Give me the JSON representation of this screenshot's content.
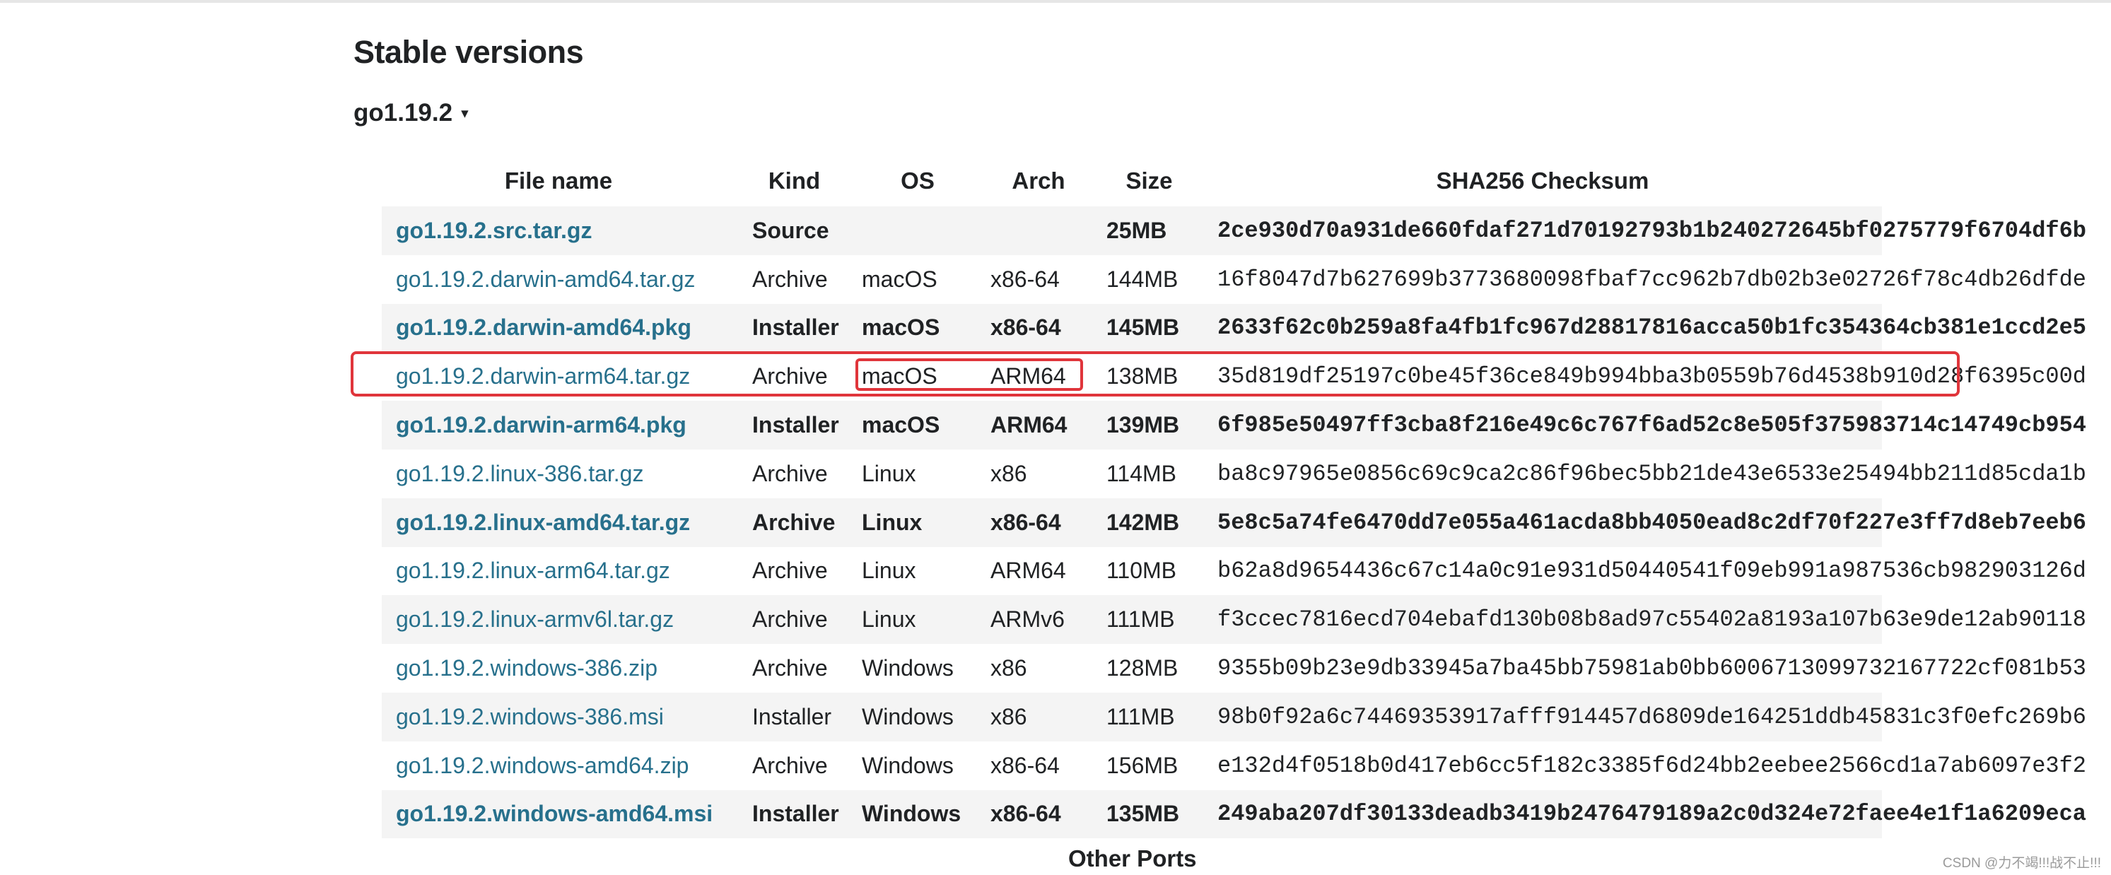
{
  "section": {
    "title": "Stable versions",
    "version_label": "go1.19.2",
    "version_caret": "▾"
  },
  "table": {
    "headers": {
      "file_name": "File name",
      "kind": "Kind",
      "os": "OS",
      "arch": "Arch",
      "size": "Size",
      "checksum": "SHA256 Checksum"
    },
    "rows": [
      {
        "file": "go1.19.2.src.tar.gz",
        "kind": "Source",
        "os": "",
        "arch": "",
        "size": "25MB",
        "checksum": "2ce930d70a931de660fdaf271d70192793b1b240272645bf0275779f6704df6b",
        "featured": true
      },
      {
        "file": "go1.19.2.darwin-amd64.tar.gz",
        "kind": "Archive",
        "os": "macOS",
        "arch": "x86-64",
        "size": "144MB",
        "checksum": "16f8047d7b627699b3773680098fbaf7cc962b7db02b3e02726f78c4db26dfde",
        "featured": false
      },
      {
        "file": "go1.19.2.darwin-amd64.pkg",
        "kind": "Installer",
        "os": "macOS",
        "arch": "x86-64",
        "size": "145MB",
        "checksum": "2633f62c0b259a8fa4fb1fc967d28817816acca50b1fc354364cb381e1ccd2e5",
        "featured": true
      },
      {
        "file": "go1.19.2.darwin-arm64.tar.gz",
        "kind": "Archive",
        "os": "macOS",
        "arch": "ARM64",
        "size": "138MB",
        "checksum": "35d819df25197c0be45f36ce849b994bba3b0559b76d4538b910d28f6395c00d",
        "featured": false
      },
      {
        "file": "go1.19.2.darwin-arm64.pkg",
        "kind": "Installer",
        "os": "macOS",
        "arch": "ARM64",
        "size": "139MB",
        "checksum": "6f985e50497ff3cba8f216e49c6c767f6ad52c8e505f375983714c14749cb954",
        "featured": true
      },
      {
        "file": "go1.19.2.linux-386.tar.gz",
        "kind": "Archive",
        "os": "Linux",
        "arch": "x86",
        "size": "114MB",
        "checksum": "ba8c97965e0856c69c9ca2c86f96bec5bb21de43e6533e25494bb211d85cda1b",
        "featured": false
      },
      {
        "file": "go1.19.2.linux-amd64.tar.gz",
        "kind": "Archive",
        "os": "Linux",
        "arch": "x86-64",
        "size": "142MB",
        "checksum": "5e8c5a74fe6470dd7e055a461acda8bb4050ead8c2df70f227e3ff7d8eb7eeb6",
        "featured": true
      },
      {
        "file": "go1.19.2.linux-arm64.tar.gz",
        "kind": "Archive",
        "os": "Linux",
        "arch": "ARM64",
        "size": "110MB",
        "checksum": "b62a8d9654436c67c14a0c91e931d50440541f09eb991a987536cb982903126d",
        "featured": false
      },
      {
        "file": "go1.19.2.linux-armv6l.tar.gz",
        "kind": "Archive",
        "os": "Linux",
        "arch": "ARMv6",
        "size": "111MB",
        "checksum": "f3ccec7816ecd704ebafd130b08b8ad97c55402a8193a107b63e9de12ab90118",
        "featured": false
      },
      {
        "file": "go1.19.2.windows-386.zip",
        "kind": "Archive",
        "os": "Windows",
        "arch": "x86",
        "size": "128MB",
        "checksum": "9355b09b23e9db33945a7ba45bb75981ab0bb6006713099732167722cf081b53",
        "featured": false
      },
      {
        "file": "go1.19.2.windows-386.msi",
        "kind": "Installer",
        "os": "Windows",
        "arch": "x86",
        "size": "111MB",
        "checksum": "98b0f92a6c74469353917afff914457d6809de164251ddb45831c3f0efc269b6",
        "featured": false
      },
      {
        "file": "go1.19.2.windows-amd64.zip",
        "kind": "Archive",
        "os": "Windows",
        "arch": "x86-64",
        "size": "156MB",
        "checksum": "e132d4f0518b0d417eb6cc5f182c3385f6d24bb2eebee2566cd1a7ab6097e3f2",
        "featured": false
      },
      {
        "file": "go1.19.2.windows-amd64.msi",
        "kind": "Installer",
        "os": "Windows",
        "arch": "x86-64",
        "size": "135MB",
        "checksum": "249aba207df30133deadb3419b2476479189a2c0d324e72faee4e1f1a6209eca",
        "featured": true
      }
    ]
  },
  "other_ports_label": "Other Ports",
  "watermark": "CSDN @力不竭!!!战不止!!!",
  "colors": {
    "link": "#27708c",
    "highlight": "#e0353b",
    "row_stripe": "#f4f4f4"
  }
}
